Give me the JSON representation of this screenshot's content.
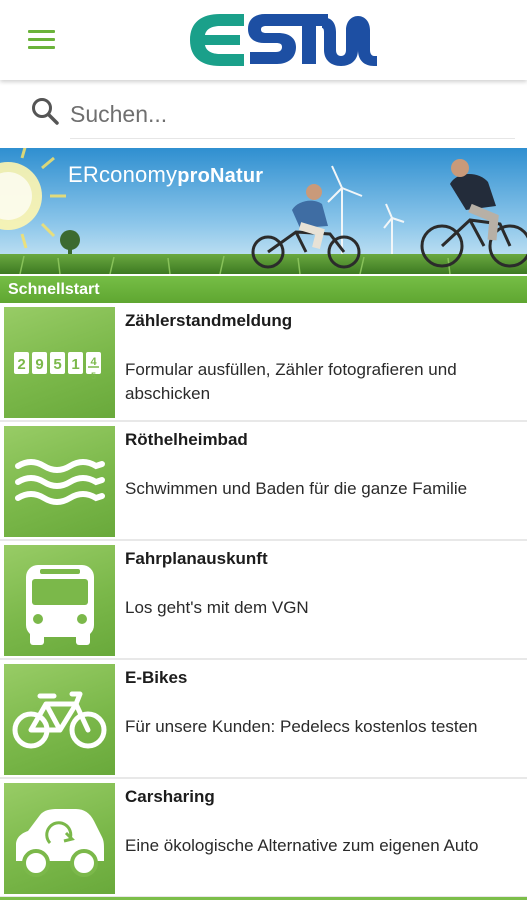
{
  "header": {
    "menu_icon": "hamburger-menu-icon",
    "logo_text": "ESTW",
    "brand_colors": {
      "green": "#6bb33a",
      "teal": "#1aa08a",
      "blue": "#1d4fa3"
    }
  },
  "search": {
    "icon": "search-icon",
    "placeholder": "Suchen..."
  },
  "banner": {
    "caption_part1": "ERconomy",
    "caption_part2": "proNatur"
  },
  "quickstart": {
    "heading": "Schnellstart",
    "items": [
      {
        "title": "Zählerstandmeldung",
        "description": "Formular ausfüllen, Zähler fotografieren und abschicken",
        "icon": "meter-counter-icon",
        "counter_digits": [
          "2",
          "9",
          "5",
          "1",
          "4"
        ]
      },
      {
        "title": "Röthelheimbad",
        "description": "Schwimmen und Baden für die ganze Familie",
        "icon": "water-waves-icon"
      },
      {
        "title": "Fahrplanauskunft",
        "description": "Los geht's mit dem VGN",
        "icon": "bus-icon"
      },
      {
        "title": "E-Bikes",
        "description": "Für unsere Kunden: Pedelecs kostenlos testen",
        "icon": "bicycle-icon"
      },
      {
        "title": "Carsharing",
        "description": "Eine ökologische Alternative zum eigenen Auto",
        "icon": "electric-car-icon"
      }
    ]
  },
  "colors": {
    "accent_green": "#76be46",
    "tile_green": "#7bb84a"
  }
}
